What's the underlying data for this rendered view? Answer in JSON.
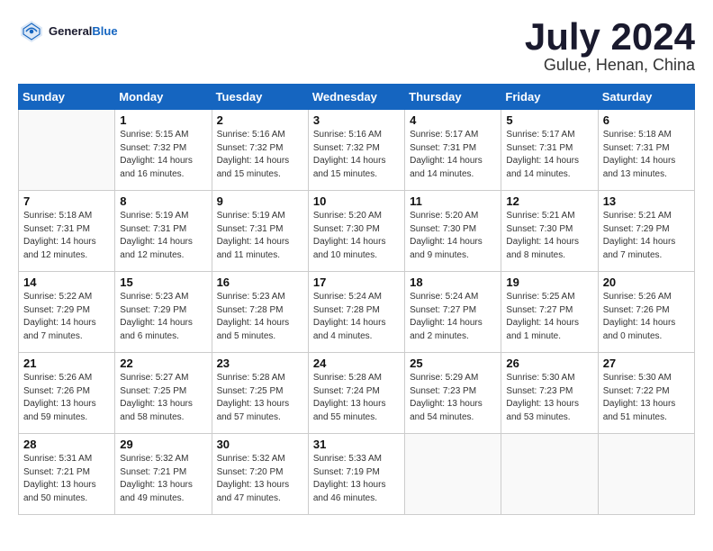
{
  "header": {
    "logo_general": "General",
    "logo_blue": "Blue",
    "month_title": "July 2024",
    "location": "Gulue, Henan, China"
  },
  "weekdays": [
    "Sunday",
    "Monday",
    "Tuesday",
    "Wednesday",
    "Thursday",
    "Friday",
    "Saturday"
  ],
  "weeks": [
    [
      {
        "day": "",
        "info": ""
      },
      {
        "day": "1",
        "info": "Sunrise: 5:15 AM\nSunset: 7:32 PM\nDaylight: 14 hours\nand 16 minutes."
      },
      {
        "day": "2",
        "info": "Sunrise: 5:16 AM\nSunset: 7:32 PM\nDaylight: 14 hours\nand 15 minutes."
      },
      {
        "day": "3",
        "info": "Sunrise: 5:16 AM\nSunset: 7:32 PM\nDaylight: 14 hours\nand 15 minutes."
      },
      {
        "day": "4",
        "info": "Sunrise: 5:17 AM\nSunset: 7:31 PM\nDaylight: 14 hours\nand 14 minutes."
      },
      {
        "day": "5",
        "info": "Sunrise: 5:17 AM\nSunset: 7:31 PM\nDaylight: 14 hours\nand 14 minutes."
      },
      {
        "day": "6",
        "info": "Sunrise: 5:18 AM\nSunset: 7:31 PM\nDaylight: 14 hours\nand 13 minutes."
      }
    ],
    [
      {
        "day": "7",
        "info": "Sunrise: 5:18 AM\nSunset: 7:31 PM\nDaylight: 14 hours\nand 12 minutes."
      },
      {
        "day": "8",
        "info": "Sunrise: 5:19 AM\nSunset: 7:31 PM\nDaylight: 14 hours\nand 12 minutes."
      },
      {
        "day": "9",
        "info": "Sunrise: 5:19 AM\nSunset: 7:31 PM\nDaylight: 14 hours\nand 11 minutes."
      },
      {
        "day": "10",
        "info": "Sunrise: 5:20 AM\nSunset: 7:30 PM\nDaylight: 14 hours\nand 10 minutes."
      },
      {
        "day": "11",
        "info": "Sunrise: 5:20 AM\nSunset: 7:30 PM\nDaylight: 14 hours\nand 9 minutes."
      },
      {
        "day": "12",
        "info": "Sunrise: 5:21 AM\nSunset: 7:30 PM\nDaylight: 14 hours\nand 8 minutes."
      },
      {
        "day": "13",
        "info": "Sunrise: 5:21 AM\nSunset: 7:29 PM\nDaylight: 14 hours\nand 7 minutes."
      }
    ],
    [
      {
        "day": "14",
        "info": "Sunrise: 5:22 AM\nSunset: 7:29 PM\nDaylight: 14 hours\nand 7 minutes."
      },
      {
        "day": "15",
        "info": "Sunrise: 5:23 AM\nSunset: 7:29 PM\nDaylight: 14 hours\nand 6 minutes."
      },
      {
        "day": "16",
        "info": "Sunrise: 5:23 AM\nSunset: 7:28 PM\nDaylight: 14 hours\nand 5 minutes."
      },
      {
        "day": "17",
        "info": "Sunrise: 5:24 AM\nSunset: 7:28 PM\nDaylight: 14 hours\nand 4 minutes."
      },
      {
        "day": "18",
        "info": "Sunrise: 5:24 AM\nSunset: 7:27 PM\nDaylight: 14 hours\nand 2 minutes."
      },
      {
        "day": "19",
        "info": "Sunrise: 5:25 AM\nSunset: 7:27 PM\nDaylight: 14 hours\nand 1 minute."
      },
      {
        "day": "20",
        "info": "Sunrise: 5:26 AM\nSunset: 7:26 PM\nDaylight: 14 hours\nand 0 minutes."
      }
    ],
    [
      {
        "day": "21",
        "info": "Sunrise: 5:26 AM\nSunset: 7:26 PM\nDaylight: 13 hours\nand 59 minutes."
      },
      {
        "day": "22",
        "info": "Sunrise: 5:27 AM\nSunset: 7:25 PM\nDaylight: 13 hours\nand 58 minutes."
      },
      {
        "day": "23",
        "info": "Sunrise: 5:28 AM\nSunset: 7:25 PM\nDaylight: 13 hours\nand 57 minutes."
      },
      {
        "day": "24",
        "info": "Sunrise: 5:28 AM\nSunset: 7:24 PM\nDaylight: 13 hours\nand 55 minutes."
      },
      {
        "day": "25",
        "info": "Sunrise: 5:29 AM\nSunset: 7:23 PM\nDaylight: 13 hours\nand 54 minutes."
      },
      {
        "day": "26",
        "info": "Sunrise: 5:30 AM\nSunset: 7:23 PM\nDaylight: 13 hours\nand 53 minutes."
      },
      {
        "day": "27",
        "info": "Sunrise: 5:30 AM\nSunset: 7:22 PM\nDaylight: 13 hours\nand 51 minutes."
      }
    ],
    [
      {
        "day": "28",
        "info": "Sunrise: 5:31 AM\nSunset: 7:21 PM\nDaylight: 13 hours\nand 50 minutes."
      },
      {
        "day": "29",
        "info": "Sunrise: 5:32 AM\nSunset: 7:21 PM\nDaylight: 13 hours\nand 49 minutes."
      },
      {
        "day": "30",
        "info": "Sunrise: 5:32 AM\nSunset: 7:20 PM\nDaylight: 13 hours\nand 47 minutes."
      },
      {
        "day": "31",
        "info": "Sunrise: 5:33 AM\nSunset: 7:19 PM\nDaylight: 13 hours\nand 46 minutes."
      },
      {
        "day": "",
        "info": ""
      },
      {
        "day": "",
        "info": ""
      },
      {
        "day": "",
        "info": ""
      }
    ]
  ]
}
